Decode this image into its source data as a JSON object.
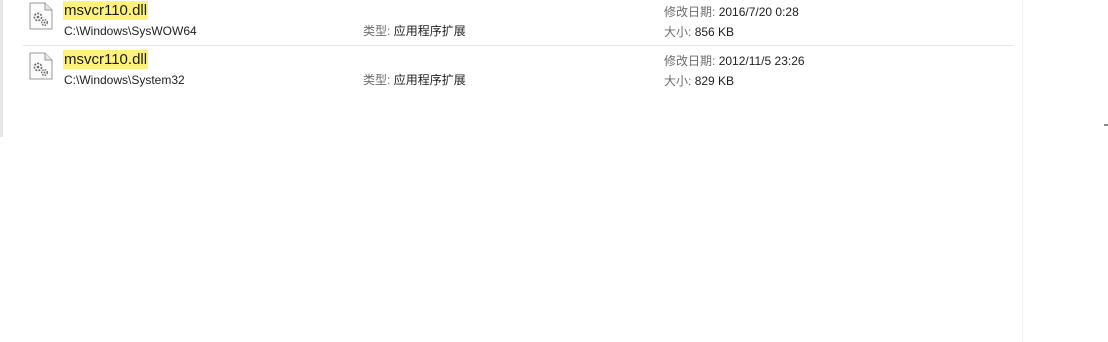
{
  "results": [
    {
      "name": "msvcr110.dll",
      "path": "C:\\Windows\\SysWOW64",
      "type_label": "类型:",
      "type_value": "应用程序扩展",
      "date_label": "修改日期:",
      "date_value": "2016/7/20 0:28",
      "size_label": "大小:",
      "size_value": "856 KB",
      "icon": "dll-settings-file-icon"
    },
    {
      "name": "msvcr110.dll",
      "path": "C:\\Windows\\System32",
      "type_label": "类型:",
      "type_value": "应用程序扩展",
      "date_label": "修改日期:",
      "date_value": "2012/11/5 23:26",
      "size_label": "大小:",
      "size_value": "829 KB",
      "icon": "dll-settings-file-icon"
    }
  ],
  "colors": {
    "highlight": "#fff27a",
    "separator": "#e5e5e5",
    "label_gray": "#6d6d6d"
  }
}
